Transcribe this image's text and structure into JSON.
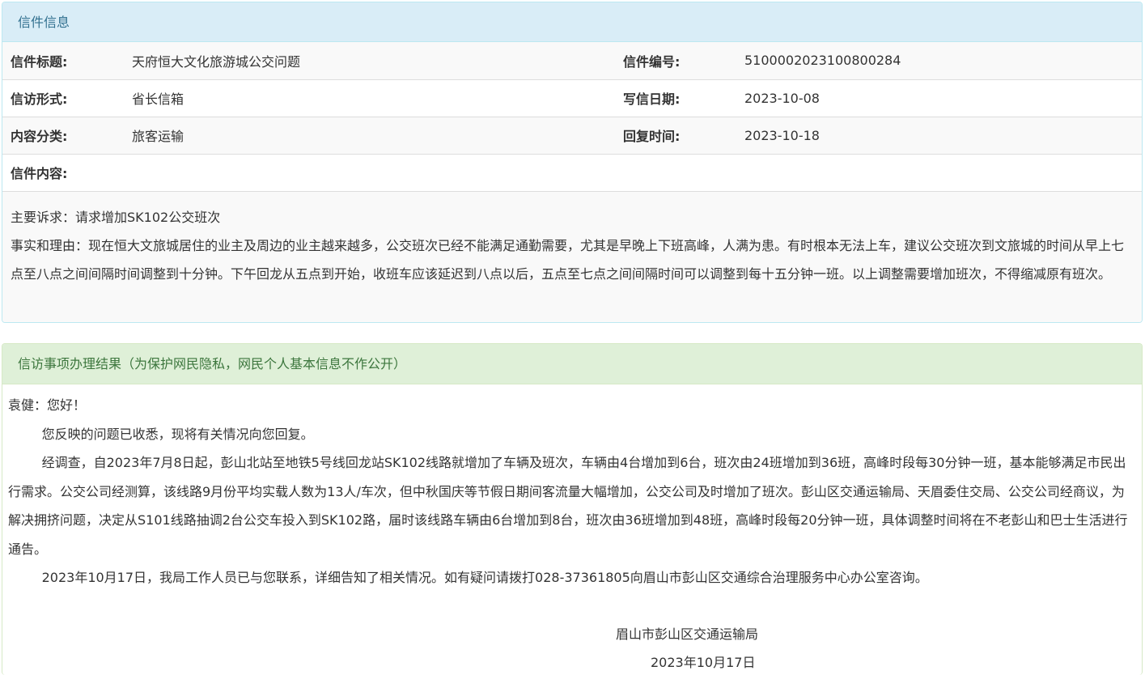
{
  "letter_panel": {
    "heading": "信件信息",
    "rows": [
      {
        "label1": "信件标题:",
        "value1": "天府恒大文化旅游城公交问题",
        "label2": "信件编号:",
        "value2": "5100002023100800284"
      },
      {
        "label1": "信访形式:",
        "value1": "省长信箱",
        "label2": "写信日期:",
        "value2": "2023-10-08"
      },
      {
        "label1": "内容分类:",
        "value1": "旅客运输",
        "label2": "回复时间:",
        "value2": "2023-10-18"
      }
    ],
    "content_label": "信件内容:",
    "content_lines": [
      "主要诉求：请求增加SK102公交班次",
      "事实和理由：现在恒大文旅城居住的业主及周边的业主越来越多，公交班次已经不能满足通勤需要，尤其是早晚上下班高峰，人满为患。有时根本无法上车，建议公交班次到文旅城的时间从早上七点至八点之间间隔时间调整到十分钟。下午回龙从五点到开始，收班车应该延迟到八点以后，五点至七点之间间隔时间可以调整到每十五分钟一班。以上调整需要增加班次，不得缩减原有班次。"
    ]
  },
  "result_panel": {
    "heading": "信访事项办理结果（为保护网民隐私，网民个人基本信息不作公开）",
    "greeting": "袁健：您好！",
    "paragraphs": [
      "您反映的问题已收悉，现将有关情况向您回复。",
      "经调查，自2023年7月8日起，彭山北站至地铁5号线回龙站SK102线路就增加了车辆及班次，车辆由4台增加到6台，班次由24班增加到36班，高峰时段每30分钟一班，基本能够满足市民出行需求。公交公司经测算，该线路9月份平均实载人数为13人/车次，但中秋国庆等节假日期间客流量大幅增加，公交公司及时增加了班次。彭山区交通运输局、天眉委住交局、公交公司经商议，为解决拥挤问题，决定从S101线路抽调2台公交车投入到SK102路，届时该线路车辆由6台增加到8台，班次由36班增加到48班，高峰时段每20分钟一班，具体调整时间将在不老彭山和巴士生活进行通告。",
      "2023年10月17日，我局工作人员已与您联系，详细告知了相关情况。如有疑问请拨打028-37361805向眉山市彭山区交通综合治理服务中心办公室咨询。"
    ],
    "signature_org": "眉山市彭山区交通运输局",
    "signature_date": "2023年10月17日"
  }
}
